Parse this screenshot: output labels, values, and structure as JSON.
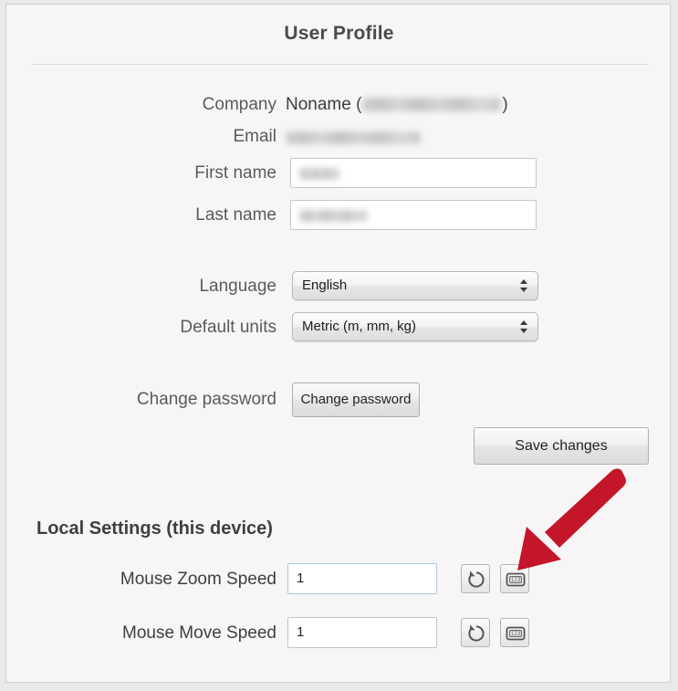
{
  "page": {
    "title": "User Profile"
  },
  "profile": {
    "company": {
      "label": "Company",
      "value_prefix": "Noname (",
      "value_suffix": ")",
      "value_redacted": true
    },
    "email": {
      "label": "Email",
      "value_redacted": true
    },
    "first_name": {
      "label": "First name",
      "value_redacted": true
    },
    "last_name": {
      "label": "Last name",
      "value_redacted": true
    },
    "language": {
      "label": "Language",
      "value": "English"
    },
    "default_units": {
      "label": "Default units",
      "value": "Metric (m, mm, kg)"
    },
    "change_password": {
      "label": "Change password",
      "button_label": "Change password"
    },
    "save_button_label": "Save changes"
  },
  "local_settings": {
    "heading": "Local Settings (this device)",
    "rows": [
      {
        "label": "Mouse Zoom Speed",
        "value": "1",
        "reset_icon": "reset-arrow-icon",
        "numeric_icon": "numeric-keypad-icon"
      },
      {
        "label": "Mouse Move Speed",
        "value": "1",
        "reset_icon": "reset-arrow-icon",
        "numeric_icon": "numeric-keypad-icon"
      }
    ]
  },
  "annotation": {
    "type": "arrow",
    "color": "#C4162A",
    "points_to": "numeric-keypad-icon-button-mouse-zoom-speed"
  },
  "colors": {
    "page_background": "#F7F5F5",
    "outer_background": "#E9E9E9",
    "label_text": "#5B5B5B",
    "heading_text": "#3F3F3F",
    "focus_border": "#A9C5DD",
    "annotation_red": "#C4162A"
  }
}
